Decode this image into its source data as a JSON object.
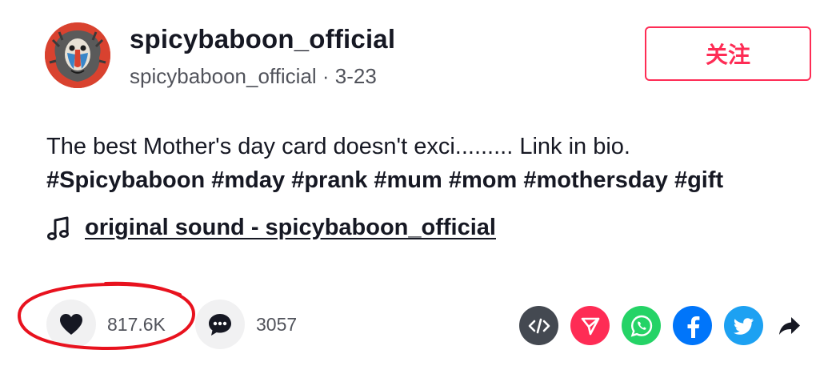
{
  "author": {
    "username": "spicybaboon_official",
    "meta": "spicybaboon_official · 3-23"
  },
  "follow_label": "关注",
  "caption": {
    "description": "The best Mother's day card doesn't exci......... Link in bio.",
    "hashtags": [
      "#Spicybaboon",
      "#mday",
      "#prank",
      "#mum",
      "#mom",
      "#mothersday",
      "#gift"
    ]
  },
  "sound": {
    "icon": "music-note-icon",
    "label": "original sound - spicybaboon_official"
  },
  "actions": {
    "like": {
      "icon": "heart-icon",
      "count": "817.6K"
    },
    "comment": {
      "icon": "comment-icon",
      "count": "3057"
    }
  },
  "share": [
    {
      "name": "embed",
      "icon": "code-icon",
      "color": "#444951"
    },
    {
      "name": "send",
      "icon": "send-icon",
      "color": "#fe2c55"
    },
    {
      "name": "whatsapp",
      "icon": "whatsapp-icon",
      "color": "#25d366"
    },
    {
      "name": "facebook",
      "icon": "facebook-icon",
      "color": "#0075fa"
    },
    {
      "name": "twitter",
      "icon": "twitter-icon",
      "color": "#1da1f2"
    },
    {
      "name": "more",
      "icon": "share-arrow-icon",
      "color": "#161823"
    }
  ],
  "colors": {
    "accent": "#fe2c55",
    "annotation": "#e8121e"
  }
}
